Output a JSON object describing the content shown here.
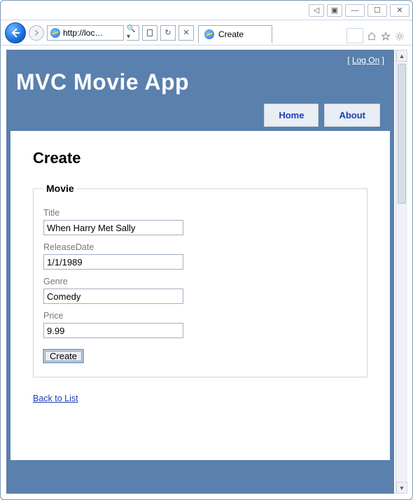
{
  "browser": {
    "address": "http://loc…",
    "tab_title": "Create"
  },
  "site": {
    "logon_bracket_open": "[ ",
    "logon_label": "Log On",
    "logon_bracket_close": " ]",
    "title": "MVC Movie App"
  },
  "nav": {
    "home": "Home",
    "about": "About"
  },
  "page": {
    "heading": "Create",
    "legend": "Movie",
    "back_link": "Back to List"
  },
  "form": {
    "title_label": "Title",
    "title_value": "When Harry Met Sally",
    "releasedate_label": "ReleaseDate",
    "releasedate_value": "1/1/1989",
    "genre_label": "Genre",
    "genre_value": "Comedy",
    "price_label": "Price",
    "price_value": "9.99",
    "submit_label": "Create"
  }
}
